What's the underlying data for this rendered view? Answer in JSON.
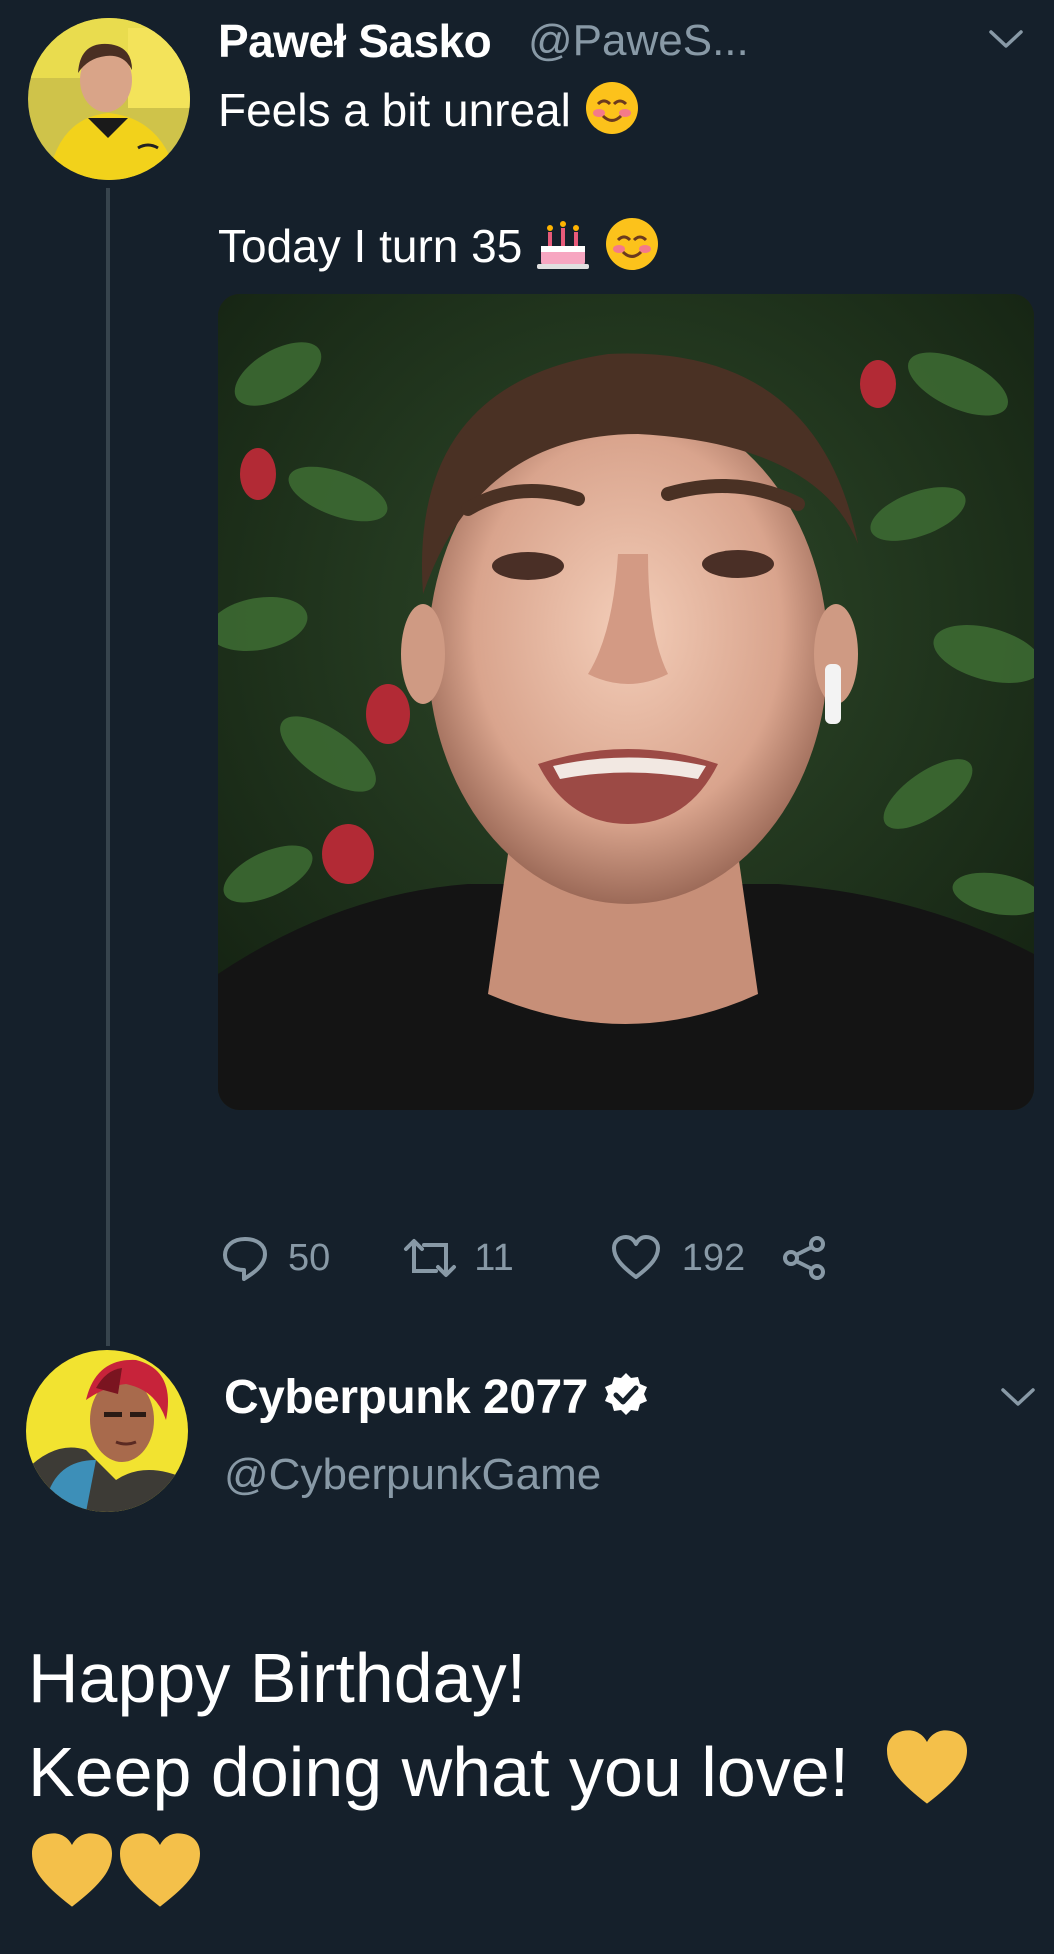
{
  "tweet": {
    "author_name": "Paweł Sasko",
    "author_handle": "@PaweS...",
    "line1": "Feels a bit unreal",
    "line2": "Today I turn 35",
    "media_alt": "Selfie video of a smiling man in front of green foliage",
    "reply_count": "50",
    "retweet_count": "11",
    "like_count": "192"
  },
  "reply": {
    "author_name": "Cyberpunk 2077",
    "author_handle": "@CyberpunkGame",
    "line1": "Happy Birthday!",
    "line2": "Keep doing what you love!"
  },
  "colors": {
    "background": "#15202b",
    "secondary_text": "#8899a6",
    "thread_line": "#37444d",
    "heart_yellow": "#f4c04a"
  },
  "icons": [
    "chevron-down-icon",
    "reply-icon",
    "retweet-icon",
    "like-icon",
    "share-icon",
    "verified-badge-icon",
    "smiling-face-emoji",
    "birthday-cake-emoji",
    "yellow-heart-emoji"
  ]
}
